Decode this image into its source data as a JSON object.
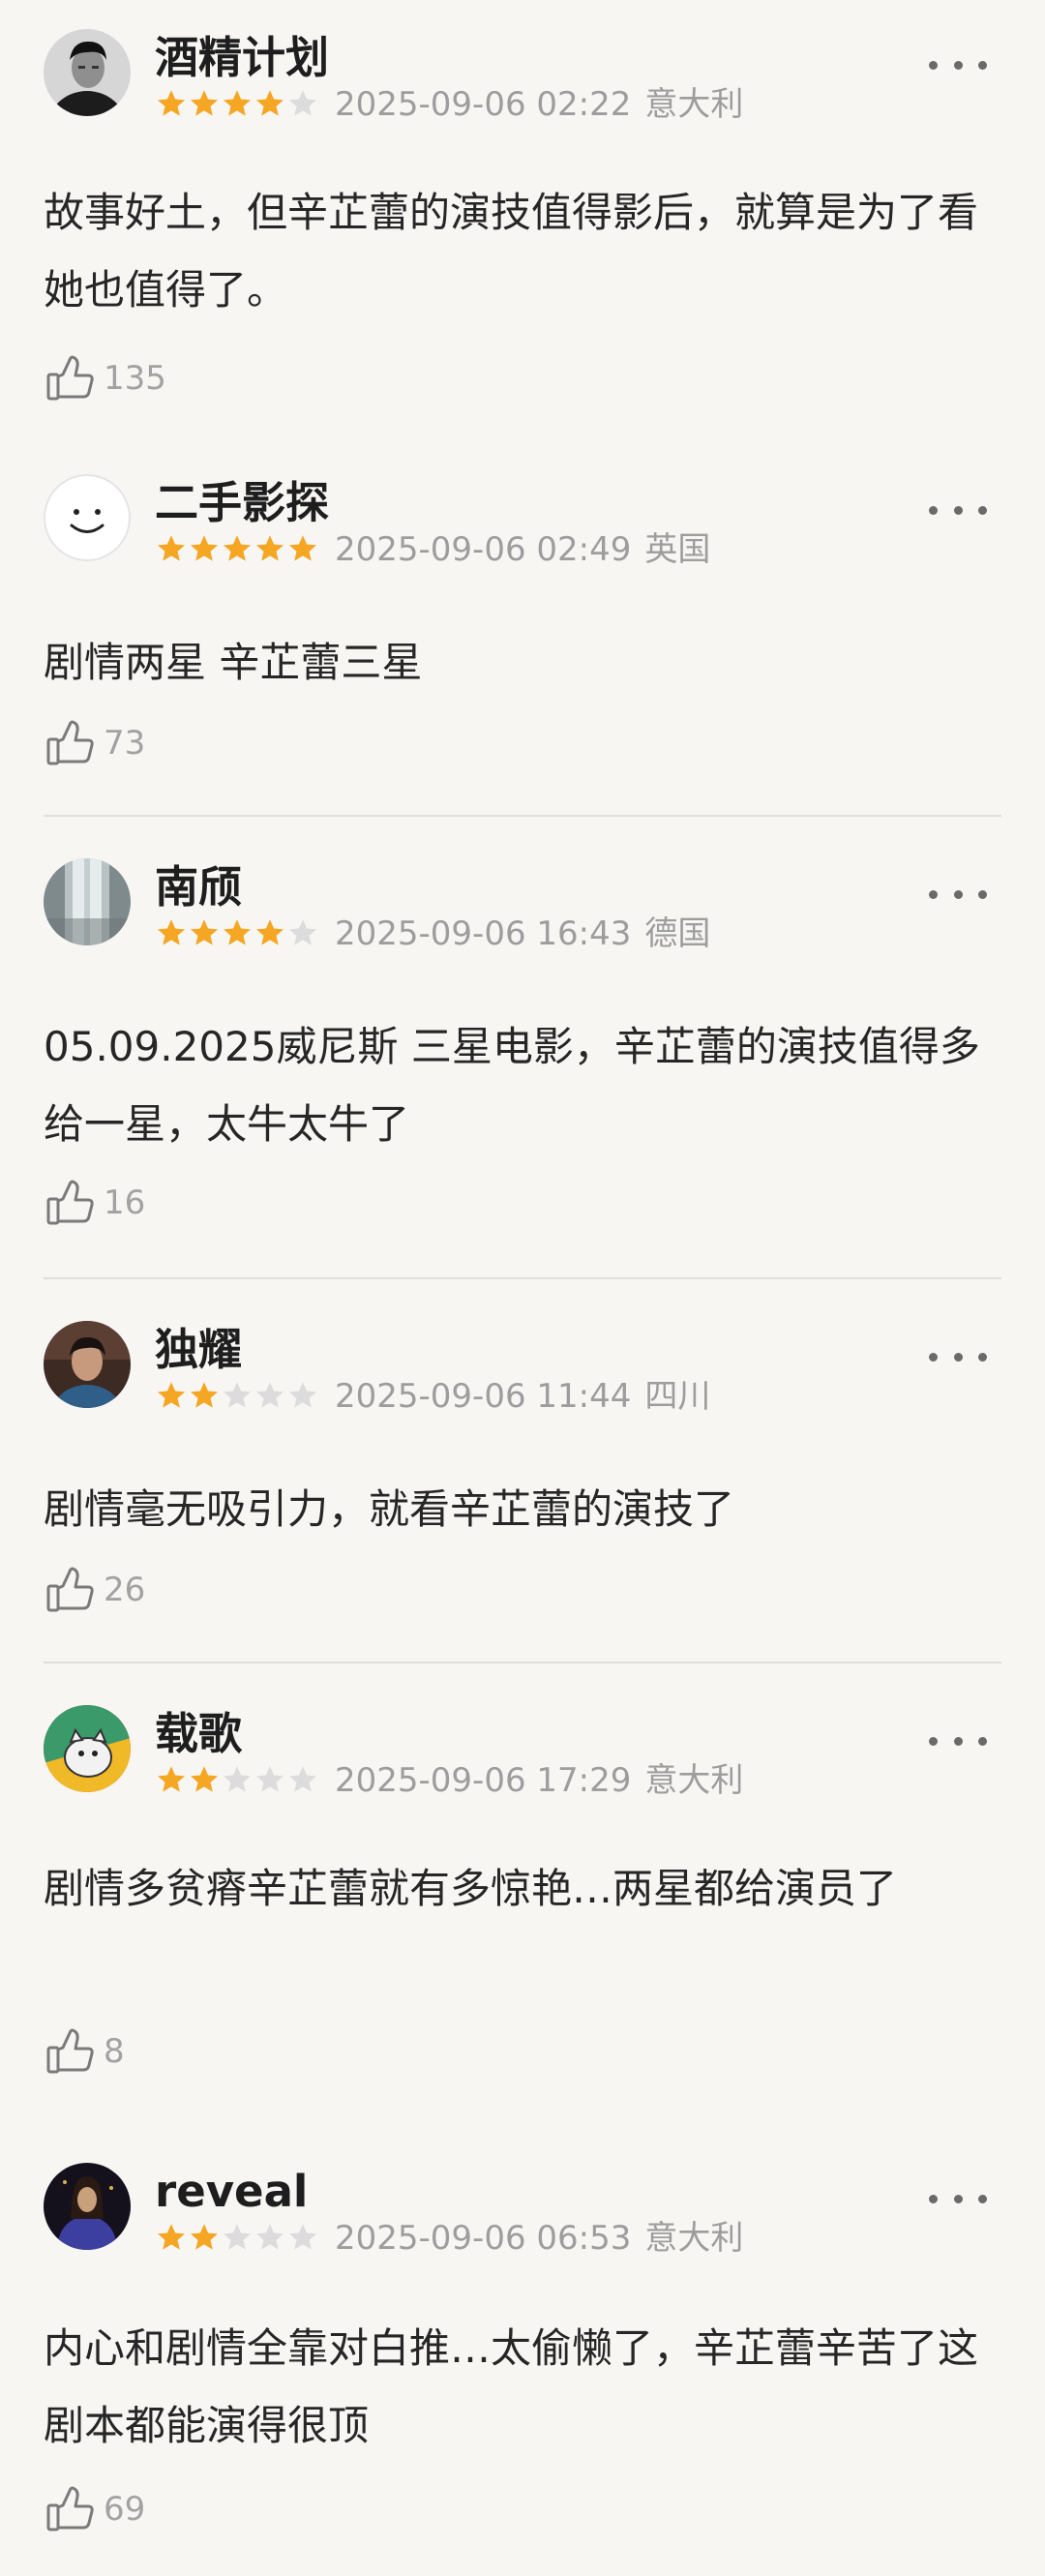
{
  "reviews": [
    {
      "username": "酒精计划",
      "rating": 4,
      "date": "2025-09-06 02:22",
      "location": "意大利",
      "content": "故事好土，但辛芷蕾的演技值得影后，就算是为了看她也值得了。",
      "likes": "135",
      "avatar_icon": "bw-portrait-man-avatar"
    },
    {
      "username": "二手影探",
      "rating": 5,
      "date": "2025-09-06 02:49",
      "location": "英国",
      "content": "剧情两星 辛芷蕾三星",
      "likes": "73",
      "avatar_icon": "smiley-face-avatar"
    },
    {
      "username": "南颀",
      "rating": 4,
      "date": "2025-09-06 16:43",
      "location": "德国",
      "content": "05.09.2025威尼斯  三星电影，辛芷蕾的演技值得多给一星，太牛太牛了",
      "likes": "16",
      "avatar_icon": "window-photo-avatar"
    },
    {
      "username": "独耀",
      "rating": 2,
      "date": "2025-09-06 11:44",
      "location": "四川",
      "content": "剧情毫无吸引力，就看辛芷蕾的演技了",
      "likes": "26",
      "avatar_icon": "portrait-man-avatar"
    },
    {
      "username": "载歌",
      "rating": 2,
      "date": "2025-09-06 17:29",
      "location": "意大利",
      "content": "剧情多贫瘠辛芷蕾就有多惊艳…两星都给演员了",
      "likes": "8",
      "avatar_icon": "cartoon-cat-avatar"
    },
    {
      "username": "reveal",
      "rating": 2,
      "date": "2025-09-06 06:53",
      "location": "意大利",
      "content": "内心和剧情全靠对白推…太偷懒了，辛芷蕾辛苦了这剧本都能演得很顶",
      "likes": "69",
      "avatar_icon": "dark-figure-avatar"
    }
  ],
  "colors": {
    "background": "#f8f6f3",
    "star_filled": "#f5a623",
    "star_empty": "#dcdcdc",
    "meta_text": "#9d9d9d",
    "divider": "#e1dedb"
  },
  "icons": {
    "more": "more-dots-icon",
    "like": "thumbs-up-icon",
    "star": "star-icon"
  }
}
